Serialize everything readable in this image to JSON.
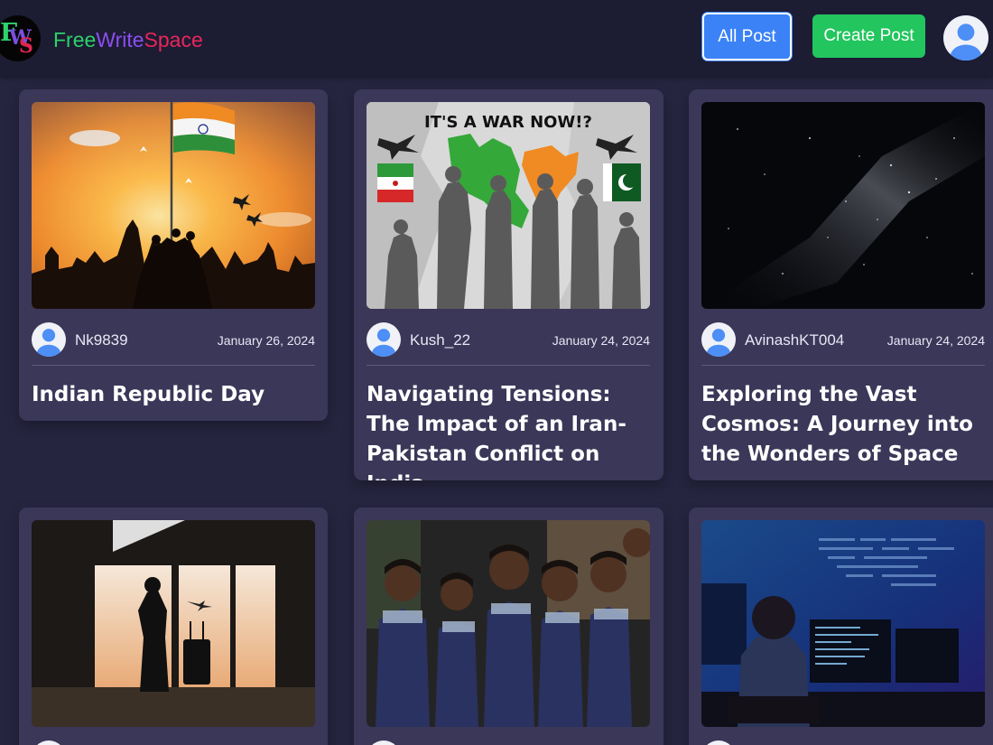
{
  "brand": {
    "logo_letters": [
      "F",
      "W",
      "S"
    ],
    "name_parts": [
      "Free",
      "Write",
      "Space"
    ]
  },
  "nav": {
    "all_post_label": "All Post",
    "create_post_label": "Create Post",
    "profile_icon": "user-avatar-icon"
  },
  "colors": {
    "background": "#262540",
    "navbar": "#1c1c33",
    "card": "#3a3758",
    "all_post_button": "#3b82f6",
    "create_post_button": "#22c55e",
    "avatar": "#4d8ef7"
  },
  "posts": [
    {
      "author": "Nk9839",
      "date": "January 26, 2024",
      "title": "Indian Republic Day",
      "image": "republic-day-image"
    },
    {
      "author": "Kush_22",
      "date": "January 24, 2024",
      "title": "Navigating Tensions: The Impact of an Iran-Pakistan Conflict on India",
      "image": "war-map-image"
    },
    {
      "author": "AvinashKT004",
      "date": "January 24, 2024",
      "title": "Exploring the Vast Cosmos: A Journey into the Wonders of Space",
      "image": "milky-way-image"
    },
    {
      "author": "",
      "date": "",
      "title": "",
      "image": "traveler-silhouette-image"
    },
    {
      "author": "",
      "date": "",
      "title": "",
      "image": "schoolchildren-image"
    },
    {
      "author": "",
      "date": "",
      "title": "",
      "image": "programmer-desk-image"
    }
  ]
}
